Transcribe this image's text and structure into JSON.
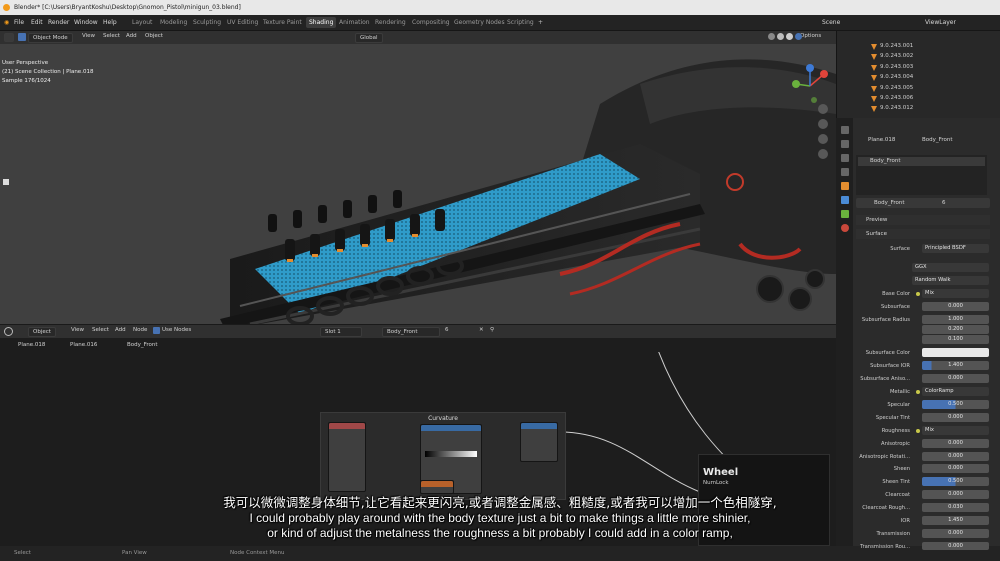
{
  "window": {
    "title": "Blender* [C:\\Users\\BryantKoshu\\Desktop\\Gnomon_Pistol\\minigun_03.blend]"
  },
  "menus": [
    "File",
    "Edit",
    "Render",
    "Window",
    "Help"
  ],
  "workspaces": [
    "Layout",
    "Modeling",
    "Sculpting",
    "UV Editing",
    "Texture Paint",
    "Shading",
    "Animation",
    "Rendering",
    "Compositing",
    "Geometry Nodes",
    "Scripting"
  ],
  "active_workspace": "Shading",
  "scene": {
    "label": "Scene",
    "view_layer": "ViewLayer"
  },
  "viewport": {
    "mode": "Object Mode",
    "menu": [
      "View",
      "Select",
      "Add",
      "Object"
    ],
    "transform": "Global",
    "options": "Options",
    "info": [
      "User Perspective",
      "(21) Scene Collection | Plane.018",
      "Sample 176/1024"
    ]
  },
  "node_editor": {
    "mode": "Object",
    "menu": [
      "View",
      "Select",
      "Add",
      "Node"
    ],
    "use_nodes": "Use Nodes",
    "slot": "Slot 1",
    "material": "Body_Front",
    "users": "6",
    "breadcrumb": [
      "Plane.018",
      "Plane.016",
      "Body_Front"
    ],
    "frame_label": "Curvature",
    "wheel_panel": {
      "title": "Wheel",
      "sub": "NumLock"
    }
  },
  "status": [
    "Select",
    "Pan View",
    "Node Context Menu"
  ],
  "outliner": {
    "items": [
      "9.0.243.001",
      "9.0.243.002",
      "9.0.243.003",
      "9.0.243.004",
      "9.0.243.005",
      "9.0.243.006",
      "9.0.243.012"
    ]
  },
  "properties": {
    "object": "Plane.018",
    "material": "Body_Front",
    "slot_item": "Body_Front",
    "material_field": "Body_Front",
    "users": "6",
    "panels": {
      "preview": "Preview",
      "surface": "Surface"
    },
    "rows": [
      {
        "label": "Surface",
        "value": "Principled BSDF"
      },
      {
        "label": "",
        "value": "GGX"
      },
      {
        "label": "",
        "value": "Random Walk"
      },
      {
        "label": "Base Color",
        "value": "Mix"
      },
      {
        "label": "Subsurface",
        "value": "0.000"
      },
      {
        "label": "Subsurface Radius",
        "value": "1.000"
      },
      {
        "label": "",
        "value": "0.200"
      },
      {
        "label": "",
        "value": "0.100"
      },
      {
        "label": "Subsurface Color",
        "value": ""
      },
      {
        "label": "Subsurface IOR",
        "value": "1.400"
      },
      {
        "label": "Subsurface Aniso...",
        "value": "0.000"
      },
      {
        "label": "Metallic",
        "value": "ColorRamp"
      },
      {
        "label": "Specular",
        "value": "0.500"
      },
      {
        "label": "Specular Tint",
        "value": "0.000"
      },
      {
        "label": "Roughness",
        "value": "Mix"
      },
      {
        "label": "Anisotropic",
        "value": "0.000"
      },
      {
        "label": "Anisotropic Rotati...",
        "value": "0.000"
      },
      {
        "label": "Sheen",
        "value": "0.000"
      },
      {
        "label": "Sheen Tint",
        "value": "0.500"
      },
      {
        "label": "Clearcoat",
        "value": "0.000"
      },
      {
        "label": "Clearcoat Rough...",
        "value": "0.030"
      },
      {
        "label": "IOR",
        "value": "1.450"
      },
      {
        "label": "Transmission",
        "value": "0.000"
      },
      {
        "label": "Transmission Rou...",
        "value": "0.000"
      }
    ]
  },
  "subtitles": {
    "zh": "我可以微微调整身体细节,让它看起来更闪亮,或者调整金属感、粗糙度,或者我可以增加一个色相隧穿,",
    "en1": "I could probably play around with the body texture just a bit to make things a little more shinier,",
    "en2": "or kind of adjust the metalness the roughness a bit probably I could add in a color ramp,"
  },
  "colors": {
    "accent": "#4772b3",
    "orange": "#e38d2f",
    "header": "#303030",
    "mesh_blue": "#2f9bc9",
    "red_tube": "#b32b22"
  }
}
